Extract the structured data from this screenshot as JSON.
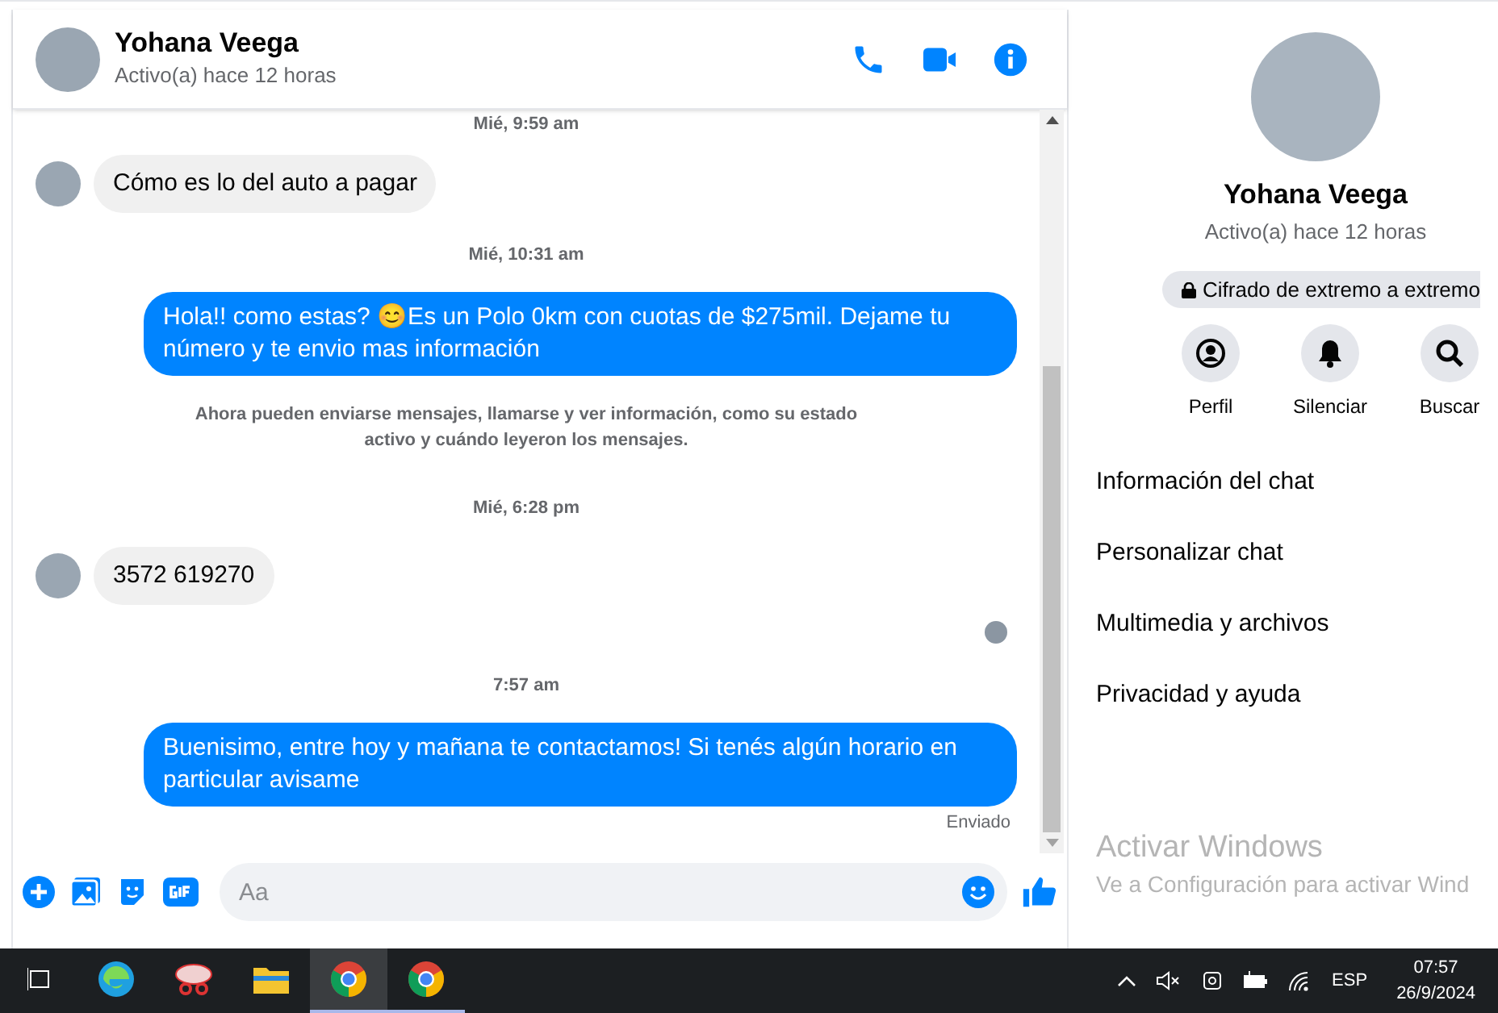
{
  "header": {
    "name": "Yohana Veega",
    "status": "Activo(a) hace 12 horas"
  },
  "messages": [
    {
      "kind": "date",
      "text": "Mié, 9:59 am"
    },
    {
      "kind": "incoming",
      "text": "Cómo es lo del auto a pagar"
    },
    {
      "kind": "date",
      "text": "Mié, 10:31 am"
    },
    {
      "kind": "outgoing",
      "text": "Hola!! como estas? 😊Es un Polo 0km con cuotas de $275mil. Dejame tu número y te envio mas información"
    },
    {
      "kind": "notice",
      "text": "Ahora pueden enviarse mensajes, llamarse y ver información, como su estado activo y cuándo leyeron los mensajes."
    },
    {
      "kind": "date",
      "text": "Mié, 6:28 pm"
    },
    {
      "kind": "incoming",
      "text": "3572 619270"
    },
    {
      "kind": "seen"
    },
    {
      "kind": "date",
      "text": "7:57 am"
    },
    {
      "kind": "outgoing",
      "text": "Buenisimo, entre hoy y mañana te contactamos! Si tenés algún horario en particular avisame"
    },
    {
      "kind": "status",
      "text": "Enviado"
    }
  ],
  "composer": {
    "placeholder": "Aa"
  },
  "profile": {
    "name": "Yohana Veega",
    "status": "Activo(a) hace 12 horas",
    "encryption": "Cifrado de extremo a extremo",
    "actions": [
      {
        "kind": "profile",
        "label": "Perfil"
      },
      {
        "kind": "mute",
        "label": "Silenciar"
      },
      {
        "kind": "search",
        "label": "Buscar"
      }
    ],
    "menu": [
      "Información del chat",
      "Personalizar chat",
      "Multimedia y archivos",
      "Privacidad y ayuda"
    ]
  },
  "activation": {
    "title": "Activar Windows",
    "subtitle": "Ve a Configuración para activar Wind"
  },
  "taskbar": {
    "apps": [
      {
        "kind": "taskview",
        "selected": false,
        "running": false
      },
      {
        "kind": "edge",
        "selected": false,
        "running": false
      },
      {
        "kind": "snip",
        "selected": false,
        "running": false
      },
      {
        "kind": "explorer",
        "selected": false,
        "running": false
      },
      {
        "kind": "chrome",
        "selected": true,
        "running": true
      },
      {
        "kind": "chrome",
        "selected": false,
        "running": true
      }
    ],
    "language": "ESP",
    "time": "07:57",
    "date": "26/9/2024"
  }
}
